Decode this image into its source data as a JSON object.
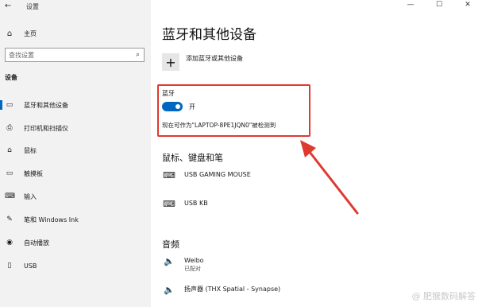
{
  "window": {
    "title": "设置",
    "back_glyph": "←",
    "controls": [
      "—",
      "☐",
      "✕"
    ]
  },
  "sidebar": {
    "home": {
      "label": "主页",
      "icon": "home-icon",
      "glyph": "⌂"
    },
    "search": {
      "placeholder": "查找设置",
      "icon": "search-icon",
      "glyph": "⌕"
    },
    "section_title": "设备",
    "items": [
      {
        "label": "蓝牙和其他设备",
        "icon": "bluetooth-devices-icon",
        "glyph": "▭",
        "selected": true
      },
      {
        "label": "打印机和扫描仪",
        "icon": "printer-icon",
        "glyph": "⎙",
        "selected": false
      },
      {
        "label": "鼠标",
        "icon": "mouse-icon",
        "glyph": "⌂",
        "selected": false
      },
      {
        "label": "触摸板",
        "icon": "touchpad-icon",
        "glyph": "▭",
        "selected": false
      },
      {
        "label": "输入",
        "icon": "keyboard-icon",
        "glyph": "⌨",
        "selected": false
      },
      {
        "label": "笔和 Windows Ink",
        "icon": "pen-icon",
        "glyph": "✎",
        "selected": false
      },
      {
        "label": "自动播放",
        "icon": "autoplay-icon",
        "glyph": "◉",
        "selected": false
      },
      {
        "label": "USB",
        "icon": "usb-icon",
        "glyph": "▯",
        "selected": false
      }
    ]
  },
  "main": {
    "title": "蓝牙和其他设备",
    "add_device": {
      "glyph": "+",
      "label": "添加蓝牙或其他设备"
    },
    "bluetooth": {
      "label": "蓝牙",
      "toggle_state": "开",
      "toggle_on": true,
      "discoverable_text": "现在可作为\"LAPTOP-8PE1JQN0\"被检测到"
    },
    "mouse_keyboard_pen": {
      "heading": "鼠标、键盘和笔",
      "devices": [
        {
          "name": "USB GAMING MOUSE",
          "icon": "keyboard-icon",
          "glyph": "⌨"
        },
        {
          "name": "USB KB",
          "icon": "keyboard-icon",
          "glyph": "⌨"
        }
      ]
    },
    "audio": {
      "heading": "音频",
      "devices": [
        {
          "name": "Weibo",
          "status": "已配对",
          "icon": "speaker-icon",
          "glyph": "🔈"
        },
        {
          "name": "扬声器 (THX Spatial - Synapse)",
          "status": "",
          "icon": "speaker-icon",
          "glyph": "🔈"
        }
      ]
    }
  },
  "annotation": {
    "color": "#e0392f"
  },
  "watermark": "@ 肥猴数码解答",
  "colors": {
    "accent": "#0067c0",
    "sidebar_bg": "#f2f2f2",
    "highlight_red": "#e0392f"
  }
}
